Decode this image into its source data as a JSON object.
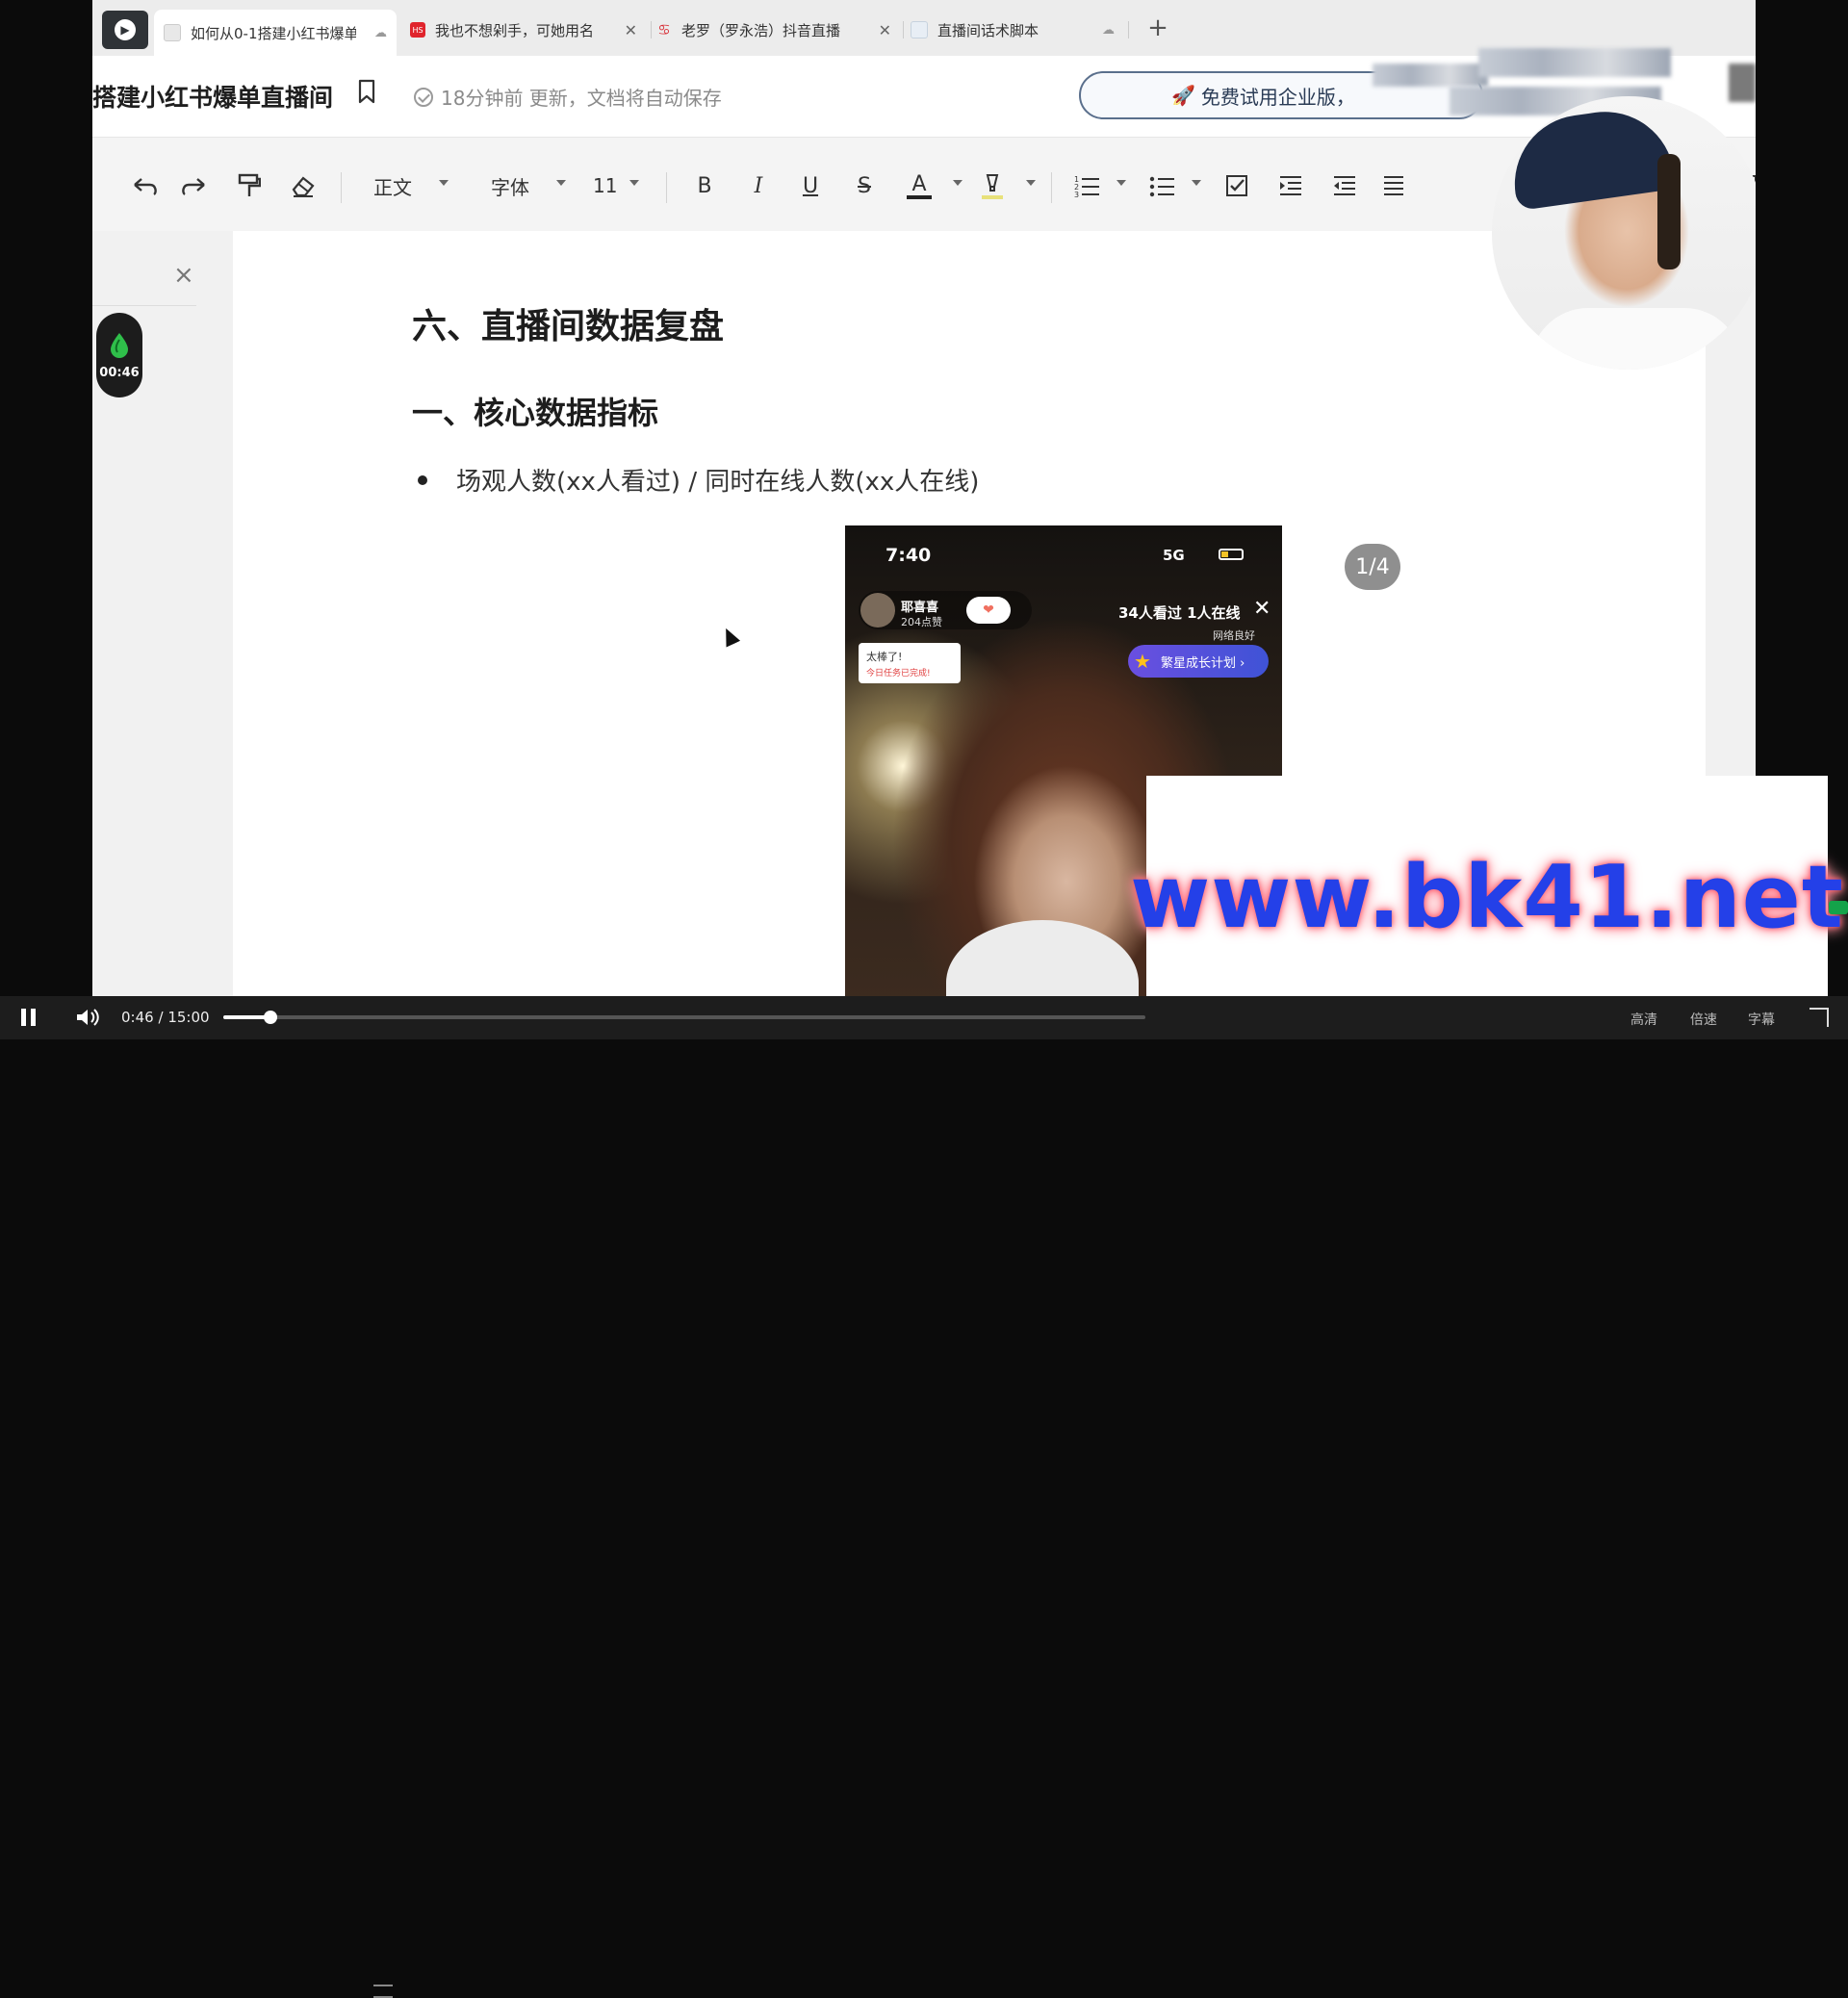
{
  "browser": {
    "tabs": [
      {
        "label": "如何从0-1搭建小红书爆单",
        "active": true
      },
      {
        "label": "我也不想剁手，可她用名",
        "active": false
      },
      {
        "label": "老罗（罗永浩）抖音直播",
        "active": false
      },
      {
        "label": "直播间话术脚本",
        "active": false
      }
    ],
    "new_tab": "+"
  },
  "header": {
    "doc_title": "搭建小红书爆单直播间",
    "save_status": "18分钟前 更新，文档将自动保存",
    "trial_button": "免费试用企业版，"
  },
  "toolbar": {
    "style": "正文",
    "font": "字体",
    "font_size": "11",
    "bold": "B",
    "italic": "I",
    "underline": "U",
    "strike": "S",
    "font_color": "A"
  },
  "sidebar": {
    "close": "×",
    "timer": "00:46"
  },
  "document": {
    "h1": "六、直播间数据复盘",
    "h2": "一、核心数据指标",
    "bullet": "场观人数(xx人看过) / 同时在线人数(xx人在线)",
    "image_counter": "1/4"
  },
  "phone": {
    "time": "7:40",
    "signal": "5G",
    "host_name": "耶喜喜",
    "host_likes": "204点赞",
    "viewers": "34人看过 1人在线",
    "network": "网络良好",
    "task_title": "太棒了!",
    "task_sub": "今日任务已完成!",
    "growth_button": "繁星成长计划 ›",
    "close": "✕"
  },
  "watermark": "www.bk41.net",
  "player": {
    "current_time": "0:46",
    "separator": "/",
    "duration": "15:00",
    "progress": 0.0511,
    "right_labels": [
      "高清",
      "倍速",
      "字幕"
    ]
  },
  "colors": {
    "accent": "#2440e8",
    "trial_border": "#5a6f8c"
  }
}
